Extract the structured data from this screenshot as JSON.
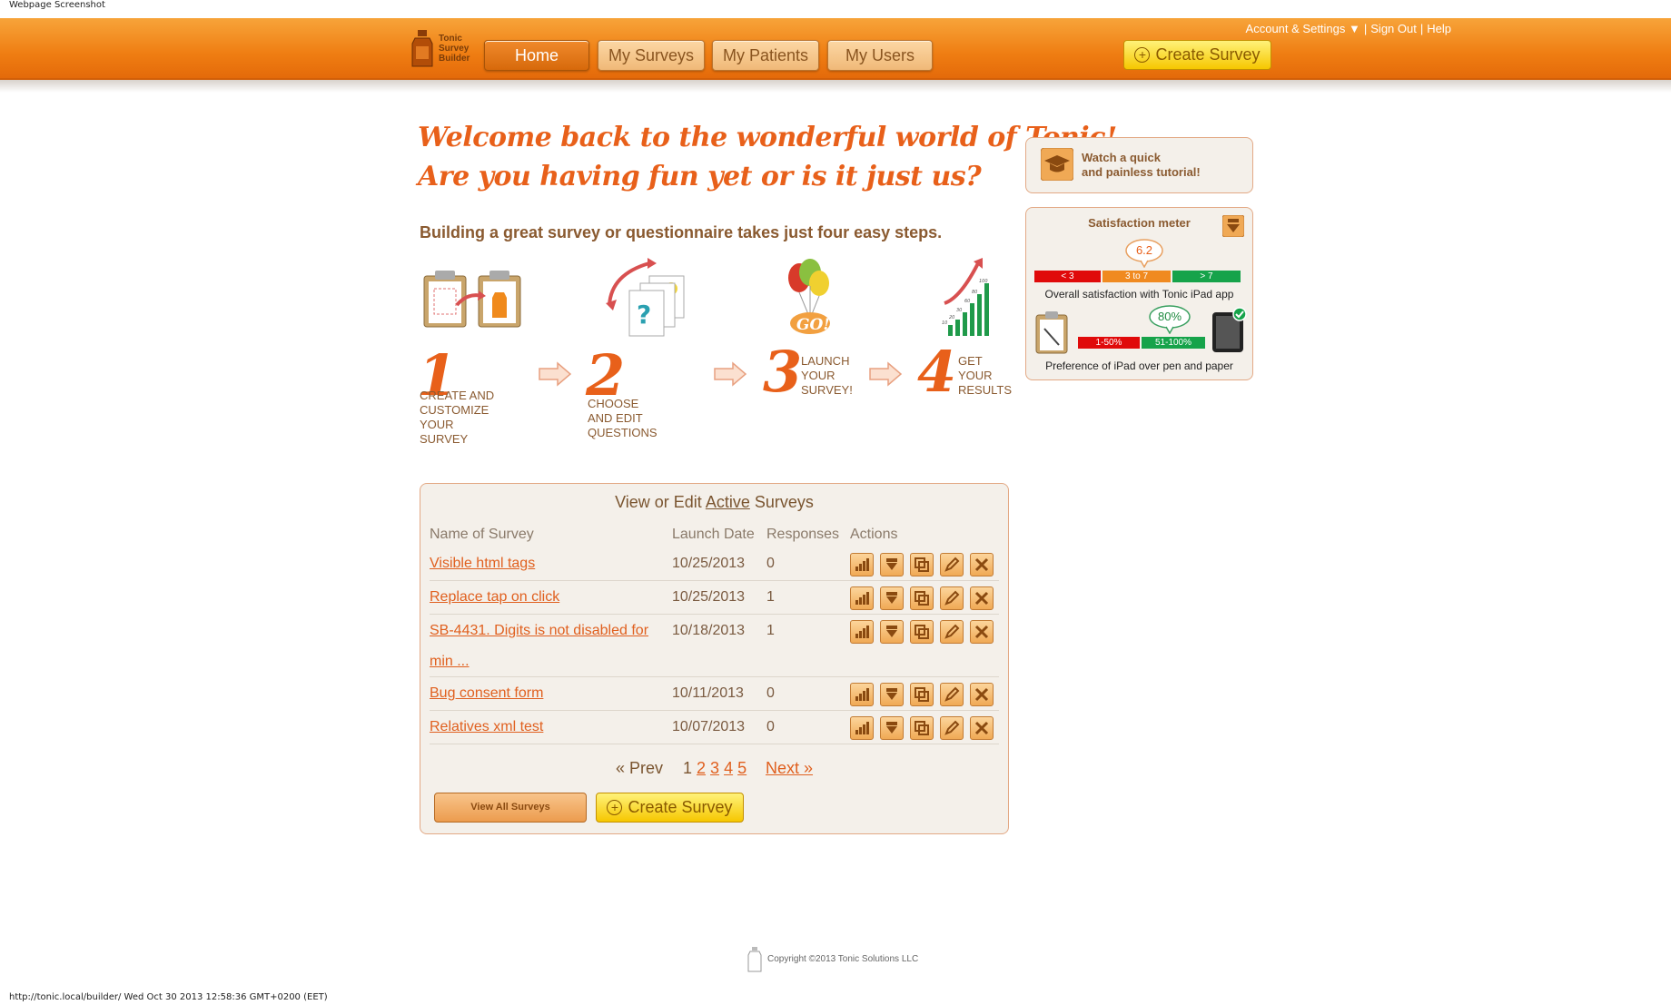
{
  "window": {
    "caption": "Webpage Screenshot",
    "status_line": "http://tonic.local/builder/ Wed Oct 30 2013 12:58:36 GMT+0200 (EET)"
  },
  "header": {
    "logo_lines": [
      "Tonic",
      "Survey",
      "Builder"
    ],
    "nav": [
      "Home",
      "My Surveys",
      "My Patients",
      "My Users"
    ],
    "account": "Account & Settings ▼",
    "signout": "Sign Out",
    "help": "Help",
    "create": "Create Survey"
  },
  "welcome": {
    "line1": "Welcome back to the wonderful world of Tonic!",
    "line2": "Are you having fun yet or is it just us?"
  },
  "steps_intro": "Building a great survey or questionnaire takes just four easy steps.",
  "steps": [
    {
      "num": "1",
      "lines": [
        "CREATE AND",
        "CUSTOMIZE",
        "YOUR",
        "SURVEY"
      ]
    },
    {
      "num": "2",
      "lines": [
        "CHOOSE",
        "AND EDIT",
        "QUESTIONS"
      ]
    },
    {
      "num": "3",
      "lines": [
        "LAUNCH",
        "YOUR",
        "SURVEY!"
      ]
    },
    {
      "num": "4",
      "lines": [
        "GET",
        "YOUR",
        "RESULTS"
      ]
    }
  ],
  "step3_badge": "GO!",
  "step4_ticks": [
    "10",
    "20",
    "30",
    "60",
    "80",
    "100"
  ],
  "surveys": {
    "title_pre": "View or Edit ",
    "title_link": "Active",
    "title_post": " Surveys",
    "columns": [
      "Name of Survey",
      "Launch Date",
      "Responses",
      "Actions"
    ],
    "rows": [
      {
        "name": "Visible html tags",
        "date": "10/25/2013",
        "responses": "0"
      },
      {
        "name": "Replace tap on click",
        "date": "10/25/2013",
        "responses": "1"
      },
      {
        "name": "SB-4431. Digits is not disabled for",
        "name2": "min ...",
        "date": "10/18/2013",
        "responses": "1"
      },
      {
        "name": "Bug consent form",
        "date": "10/11/2013",
        "responses": "0"
      },
      {
        "name": "Relatives xml test",
        "date": "10/07/2013",
        "responses": "0"
      }
    ],
    "pager": {
      "prev": "« Prev",
      "current": "1",
      "pages": [
        "2",
        "3",
        "4",
        "5"
      ],
      "next": "Next »"
    },
    "view_all": "View All Surveys",
    "create": "Create Survey"
  },
  "tutorial": {
    "line1": "Watch a quick",
    "line2": "and painless tutorial!"
  },
  "satisfaction": {
    "title": "Satisfaction meter",
    "score": "6.2",
    "bands": [
      "< 3",
      "3 to 7",
      "> 7"
    ],
    "caption1": "Overall satisfaction with Tonic iPad app",
    "percent": "80%",
    "pref_bands": [
      "1-50%",
      "51-100%"
    ],
    "caption2": "Preference of iPad over pen and paper"
  },
  "footer": {
    "copyright": "Copyright ©2013 Tonic Solutions LLC"
  }
}
